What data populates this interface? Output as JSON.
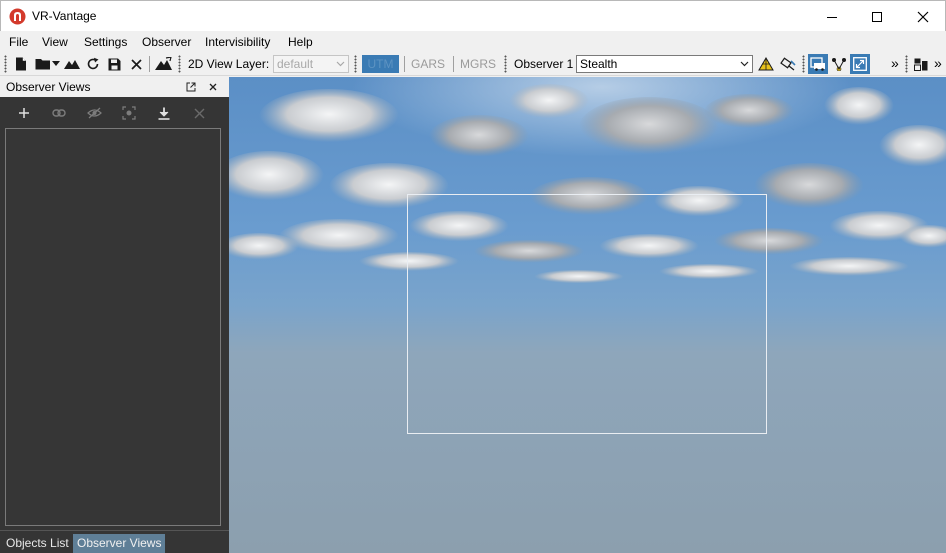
{
  "window": {
    "title": "VR-Vantage",
    "logo_icon": "vr-vantage-logo",
    "brand_color": "#d33a2c"
  },
  "menu": {
    "items": [
      "File",
      "View",
      "Settings",
      "Observer",
      "Intervisibility",
      "Help"
    ]
  },
  "toolbar": {
    "view_layer_label": "2D View Layer:",
    "view_layer_value": "default",
    "grid_buttons": [
      "UTM",
      "GARS",
      "MGRS"
    ],
    "grid_active": "UTM",
    "observer_label": "Observer 1",
    "observer_mode": "Stealth",
    "overflow_glyph": "»",
    "accent_color": "#3a7bb4"
  },
  "observer_views_panel": {
    "title": "Observer Views",
    "tabs": [
      "Objects List",
      "Observer Views"
    ],
    "active_tab": "Observer Views",
    "actions": [
      "add-view",
      "link-view",
      "hide-view",
      "capture-view",
      "download-view",
      "delete-view"
    ]
  }
}
